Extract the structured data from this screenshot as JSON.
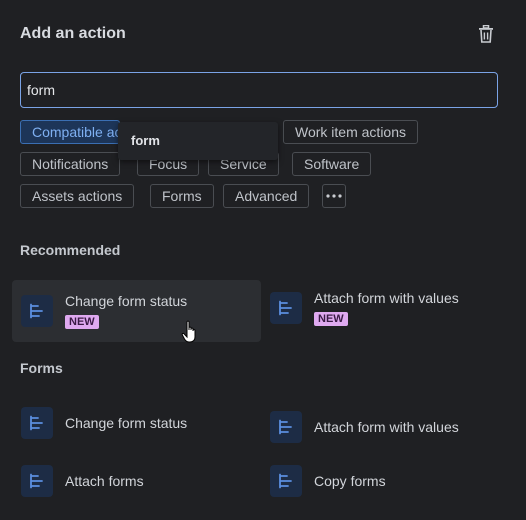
{
  "header": {
    "title": "Add an action"
  },
  "search": {
    "value": "form"
  },
  "tooltip": {
    "text": "form"
  },
  "chips": {
    "compatible": "Compatible actions",
    "work_item": "Work item actions",
    "notifications": "Notifications",
    "focus": "Focus",
    "service": "Service",
    "software": "Software",
    "assets": "Assets actions",
    "forms": "Forms",
    "advanced": "Advanced"
  },
  "recommended": {
    "title": "Recommended",
    "items": [
      {
        "label": "Change form status",
        "badge": "NEW"
      },
      {
        "label": "Attach form with values",
        "badge": "NEW"
      }
    ]
  },
  "forms": {
    "title": "Forms",
    "items": [
      {
        "label": "Change form status"
      },
      {
        "label": "Attach form with values"
      },
      {
        "label": "Attach forms"
      },
      {
        "label": "Copy forms"
      }
    ]
  }
}
